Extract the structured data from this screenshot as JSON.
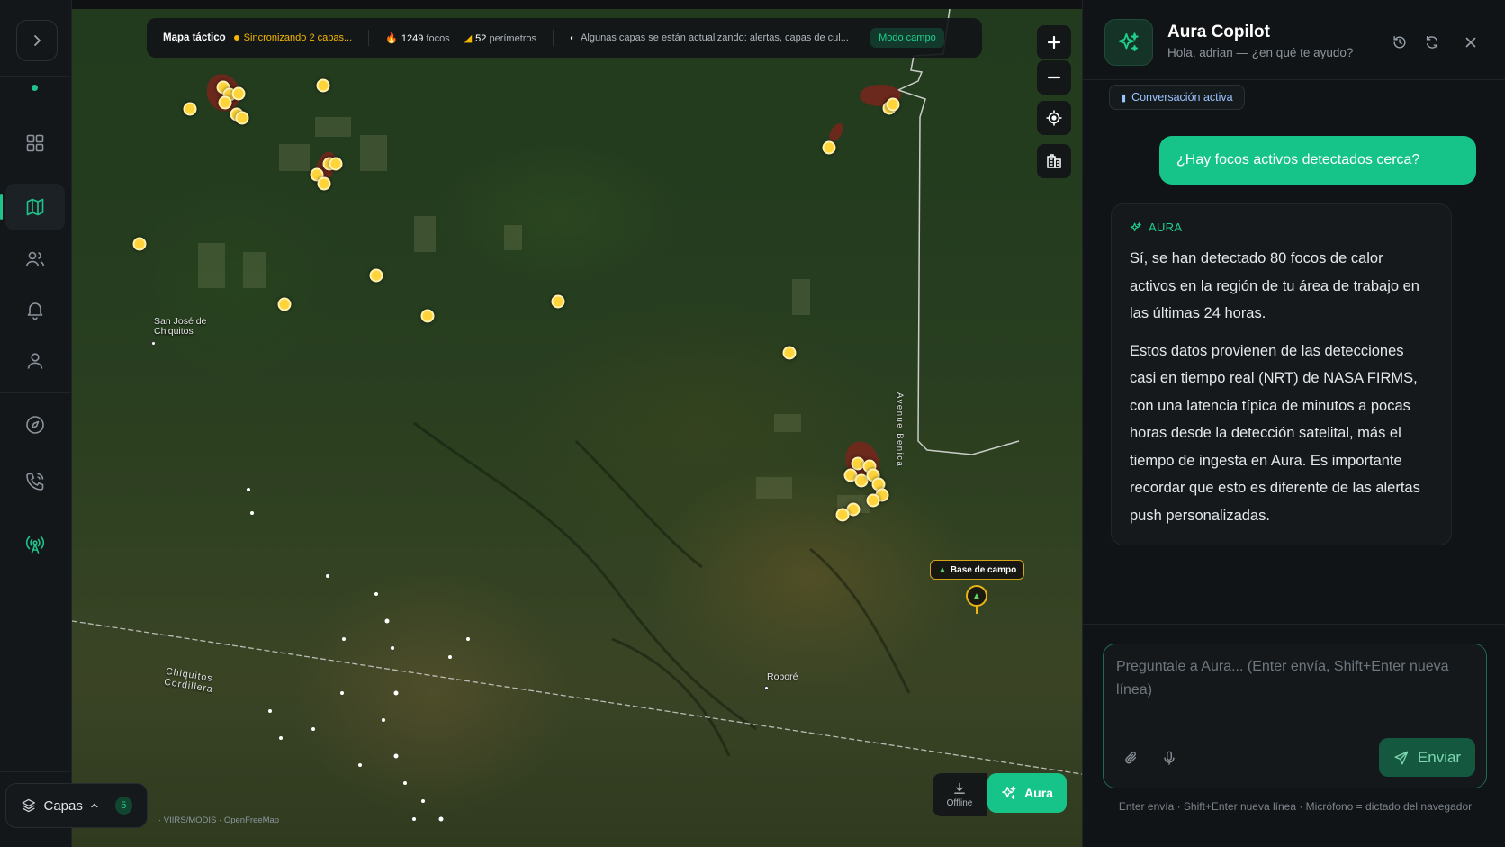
{
  "topbar": {
    "title": "Mapa táctico",
    "sync_status": "Sincronizando 2 capas...",
    "fires_count": "1249",
    "fires_unit": "focos",
    "perimeters_count": "52",
    "perimeters_unit": "perímetros",
    "warning": "Algunas capas se están actualizando: alertas, capas de cul...",
    "mode_label": "Modo campo"
  },
  "map": {
    "labels": {
      "san_jose": "San José de\nChiquitos",
      "robore": "Roboré",
      "cordillera": "Chiquitos\nCordillera",
      "road": "Avenue Benica"
    },
    "base_camp_label": "Base de campo",
    "attribution": "· VIIRS/MODIS · OpenFreeMap",
    "offline_label": "Offline",
    "aura_button_label": "Aura"
  },
  "layers": {
    "label": "Capas",
    "count": "5"
  },
  "panel": {
    "title": "Aura Copilot",
    "subtitle": "Hola, adrian — ¿en qué te ayudo?",
    "chip_label": "Conversación activa",
    "user_message": "¿Hay focos activos detectados cerca?",
    "ai_label": "AURA",
    "ai_paragraph_1": "Sí, se han detectado 80 focos de calor activos en la región de tu área de trabajo en las últimas 24 horas.",
    "ai_paragraph_2": "Estos datos provienen de las detecciones casi en tiempo real (NRT) de NASA FIRMS, con una latencia típica de minutos a pocas horas desde la detección satelital, más el tiempo de ingesta en Aura. Es importante recordar que esto es diferente de las alertas push personalizadas.",
    "composer_placeholder": "Preguntale a Aura... (Enter envía, Shift+Enter nueva línea)",
    "send_label": "Enviar",
    "hint": "Enter envía · Shift+Enter nueva línea · Micrófono = dictado del navegador"
  },
  "colors": {
    "accent": "#16c48a",
    "fire": "#ffd33a",
    "sync": "#f5b800"
  }
}
